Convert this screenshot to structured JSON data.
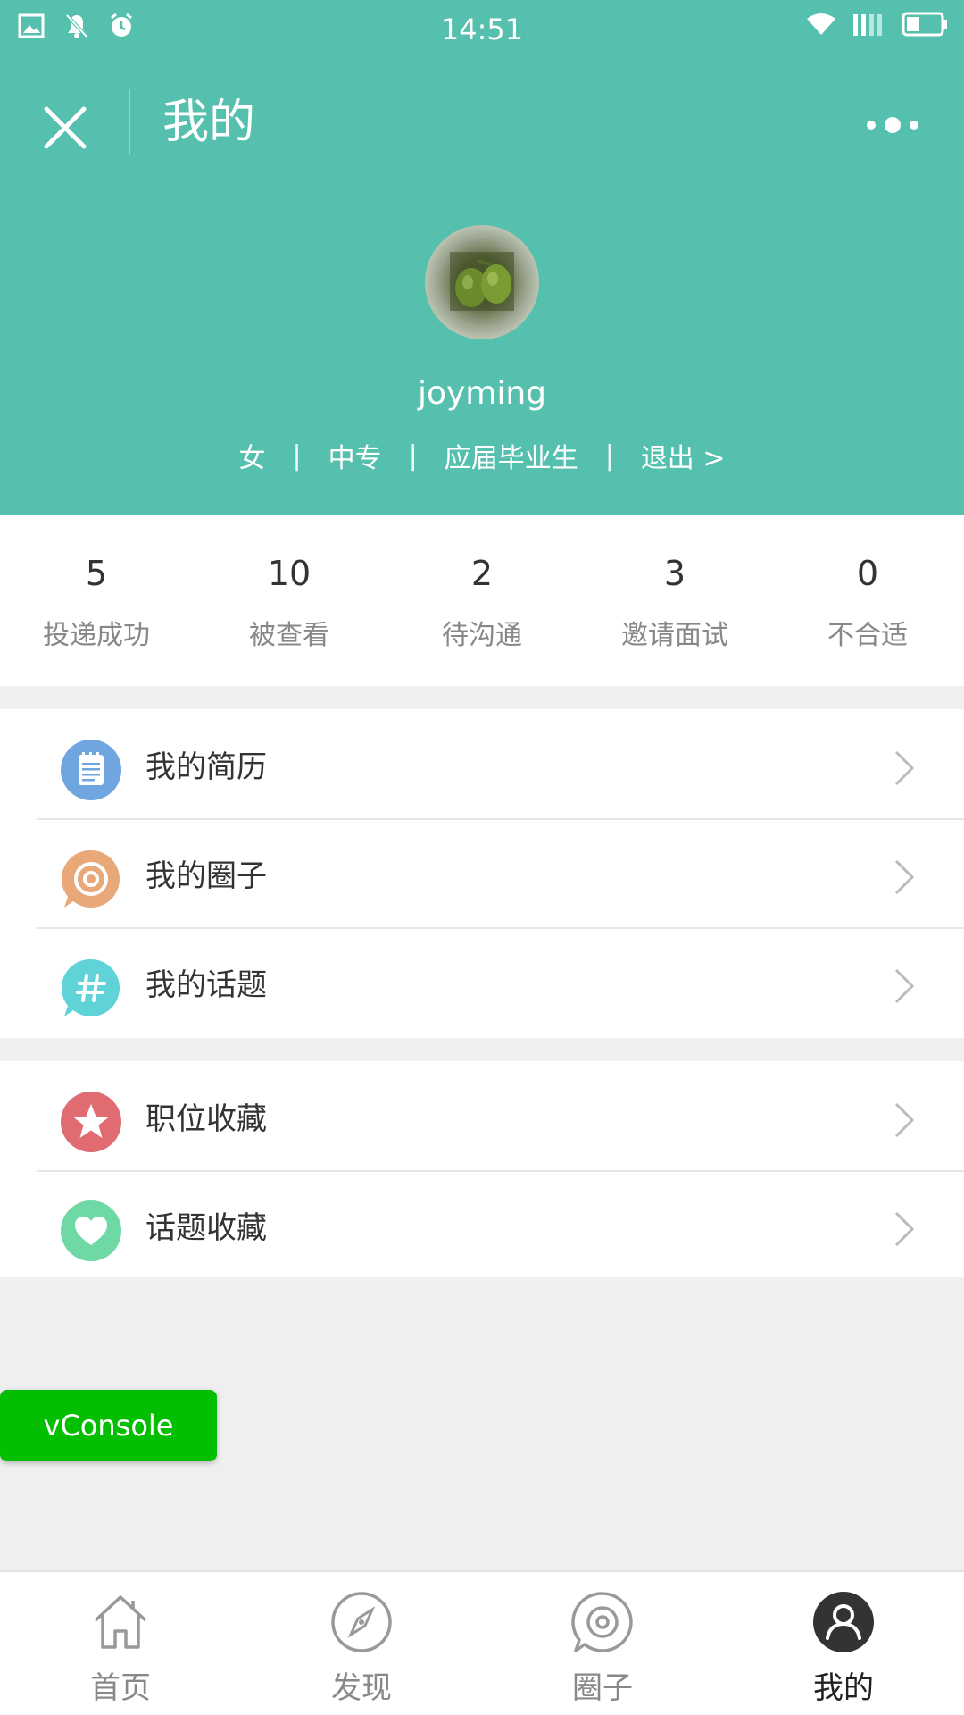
{
  "status_bar": {
    "time": "14:51"
  },
  "navbar": {
    "title": "我的"
  },
  "profile": {
    "username": "joyming",
    "tags": [
      "女",
      "中专",
      "应届毕业生"
    ],
    "separator": "|",
    "logout_label": "退出 >"
  },
  "stats": [
    {
      "value": "5",
      "label": "投递成功"
    },
    {
      "value": "10",
      "label": "被查看"
    },
    {
      "value": "2",
      "label": "待沟通"
    },
    {
      "value": "3",
      "label": "邀请面试"
    },
    {
      "value": "0",
      "label": "不合适"
    }
  ],
  "menu_group_1": [
    {
      "label": "我的简历",
      "icon": "resume-icon",
      "color": "#6fa6e0"
    },
    {
      "label": "我的圈子",
      "icon": "circle-icon",
      "color": "#e8a878"
    },
    {
      "label": "我的话题",
      "icon": "hashtag-icon",
      "color": "#5fd3d7"
    }
  ],
  "menu_group_2": [
    {
      "label": "职位收藏",
      "icon": "star-icon",
      "color": "#e06c72"
    },
    {
      "label": "话题收藏",
      "icon": "heart-icon",
      "color": "#6fd9a6"
    }
  ],
  "vconsole": {
    "label": "vConsole"
  },
  "tabbar": [
    {
      "label": "首页",
      "icon": "home-icon"
    },
    {
      "label": "发现",
      "icon": "compass-icon"
    },
    {
      "label": "圈子",
      "icon": "circle-icon"
    },
    {
      "label": "我的",
      "icon": "user-icon",
      "active": true
    }
  ],
  "colors": {
    "header": "#56c0ae",
    "vconsole": "#04be02"
  }
}
